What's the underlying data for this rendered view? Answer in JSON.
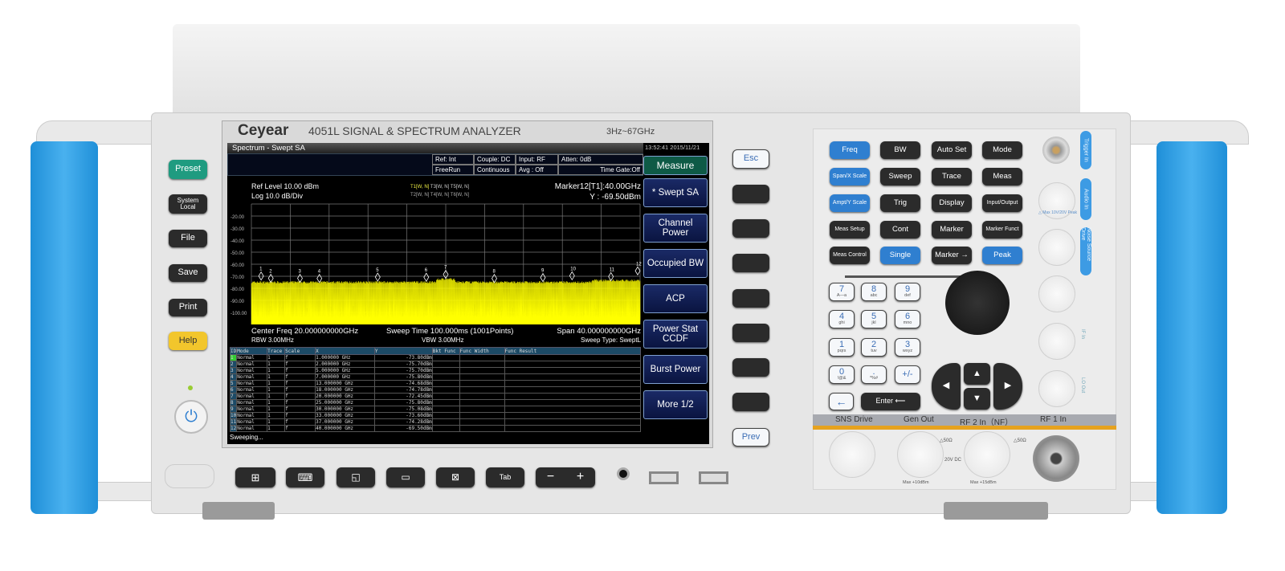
{
  "header": {
    "brand": "Ceyear",
    "model": "4051L  SIGNAL & SPECTRUM ANALYZER",
    "range": "3Hz~67GHz"
  },
  "screen": {
    "title": "Spectrum - Swept SA",
    "datetime": "13:52:41  2015/11/21",
    "status": {
      "ref": "Ref: Int",
      "couple": "Couple: DC",
      "input": "Input: RF",
      "atten": "Atten: 0dB",
      "trigger": "FreeRun",
      "sweep": "Continuous",
      "avg": "Avg : Off",
      "timegate": "Time Gate:Off"
    },
    "ref_level": "Ref Level  10.00 dBm",
    "scale": "Log 10.0 dB/Div",
    "traces_row1": [
      "T1[W, N]",
      "T3[W, N]",
      "T5[W, N]"
    ],
    "traces_row2": [
      "T2[W, N]",
      "T4[W, N]",
      "T6[W, N]"
    ],
    "marker_readout": "Marker12[T1]:40.00GHz",
    "marker_y": "Y : -69.50dBm",
    "center": "Center Freq 20.000000000GHz",
    "sweep_time": "Sweep Time 100.000ms (1001Points)",
    "span": "Span 40.000000000GHz",
    "rbw": "RBW 3.00MHz",
    "vbw": "VBW 3.00MHz",
    "sweep_type": "Sweep Type: SweptL",
    "status_line": "Sweeping...",
    "table_headers": [
      "ID",
      "Mode",
      "Trace",
      "Scale",
      "X",
      "Y",
      "Bkt Func",
      "Func Width",
      "Func Result"
    ],
    "table_rows": [
      [
        "1",
        "Normal",
        "1",
        "f",
        "1.000000 GHz",
        "-73.80dBm"
      ],
      [
        "2",
        "Normal",
        "1",
        "f",
        "2.000000 GHz",
        "-75.70dBm"
      ],
      [
        "3",
        "Normal",
        "1",
        "f",
        "5.000000 GHz",
        "-75.70dBm"
      ],
      [
        "4",
        "Normal",
        "1",
        "f",
        "7.000000 GHz",
        "-75.80dBm"
      ],
      [
        "5",
        "Normal",
        "1",
        "f",
        "13.000000 GHz",
        "-74.68dBm"
      ],
      [
        "6",
        "Normal",
        "1",
        "f",
        "18.000000 GHz",
        "-74.78dBm"
      ],
      [
        "7",
        "Normal",
        "1",
        "f",
        "20.000000 GHz",
        "-72.45dBm"
      ],
      [
        "8",
        "Normal",
        "1",
        "f",
        "25.000000 GHz",
        "-75.80dBm"
      ],
      [
        "9",
        "Normal",
        "1",
        "f",
        "30.000000 GHz",
        "-75.08dBm"
      ],
      [
        "10",
        "Normal",
        "1",
        "f",
        "33.000000 GHz",
        "-73.60dBm"
      ],
      [
        "11",
        "Normal",
        "1",
        "f",
        "37.000000 GHz",
        "-74.28dBm"
      ],
      [
        "12",
        "Normal",
        "1",
        "f",
        "40.000000 GHz",
        "-69.50dBm"
      ]
    ]
  },
  "chart_data": {
    "type": "line",
    "title": "",
    "xlabel": "",
    "ylabel": "",
    "x_range_ghz": [
      0,
      40
    ],
    "ylim": [
      -110,
      -10
    ],
    "grid": true,
    "y_ticks": [
      "-20.00",
      "-30.00",
      "-40.00",
      "-50.00",
      "-60.00",
      "-70.00",
      "-80.00",
      "-90.00",
      "-100.00"
    ],
    "trace_color": "#ffff00",
    "noise_floor_dbm": -76,
    "markers": [
      {
        "label": "1",
        "x": 1,
        "y": -73.8
      },
      {
        "label": "2",
        "x": 2,
        "y": -75.7
      },
      {
        "label": "3",
        "x": 5,
        "y": -75.7
      },
      {
        "label": "4",
        "x": 7,
        "y": -75.8
      },
      {
        "label": "5",
        "x": 13,
        "y": -74.68
      },
      {
        "label": "6",
        "x": 18,
        "y": -74.78
      },
      {
        "label": "7",
        "x": 20,
        "y": -72.45
      },
      {
        "label": "8",
        "x": 25,
        "y": -75.8
      },
      {
        "label": "9",
        "x": 30,
        "y": -75.08
      },
      {
        "label": "10",
        "x": 33,
        "y": -73.6
      },
      {
        "label": "11",
        "x": 37,
        "y": -74.28
      },
      {
        "label": "12",
        "x": 40,
        "y": -69.5
      }
    ]
  },
  "softkeys": [
    "Measure",
    "* Swept SA",
    "Channel Power",
    "Occupied BW",
    "ACP",
    "Power Stat CCDF",
    "Burst Power",
    "More 1/2"
  ],
  "side_keys": {
    "esc": "Esc",
    "prev": "Prev"
  },
  "left_keys": {
    "preset": "Preset",
    "system": "System Local",
    "file": "File",
    "save": "Save",
    "print": "Print",
    "help": "Help"
  },
  "bottom_keys": {
    "tab": "Tab",
    "minus": "−",
    "plus": "+"
  },
  "function_keys": [
    [
      "Freq",
      "BW",
      "Auto Set",
      "Mode"
    ],
    [
      "Span/X Scale",
      "Sweep",
      "Trace",
      "Meas"
    ],
    [
      "Ampt/Y Scale",
      "Trig",
      "Display",
      "Input/Output"
    ],
    [
      "Meas Setup",
      "Cont",
      "Marker",
      "Marker Funct"
    ],
    [
      "Meas Control",
      "Single",
      "Marker →",
      "Peak"
    ]
  ],
  "numpad": [
    [
      "7",
      "A—a"
    ],
    [
      "8",
      "abc"
    ],
    [
      "9",
      "def"
    ],
    [
      "4",
      "ghi"
    ],
    [
      "5",
      "jkl"
    ],
    [
      "6",
      "mno"
    ],
    [
      "1",
      "pqrs"
    ],
    [
      "2",
      "tuv"
    ],
    [
      "3",
      "wxyz"
    ],
    [
      "0",
      "!@&"
    ],
    [
      ".",
      "*%#"
    ],
    [
      "+/-",
      ""
    ]
  ],
  "enter": "Enter ⟵",
  "ports": {
    "sns": "SNS Drive",
    "gen": "Gen Out",
    "rf2": "RF 2 In（NF）",
    "rf1": "RF 1 In",
    "gen_max": "Max +10dBm",
    "rf2_max": "Max +15dBm",
    "ohm1": "△50Ω",
    "ohm2": "△50Ω",
    "dc": "20V DC"
  },
  "side_ports": [
    "Trigger In",
    "Audio In",
    "Noise Source Drive",
    "IF In",
    "LO Out"
  ],
  "side_warn": "△ Max 10V/20V Peak",
  "colors": {
    "accent_blue": "#2f7fd0",
    "handle": "#2a9be6",
    "trace": "#ffff00",
    "softkey": "#0e1a55",
    "measure": "#0e5a46"
  }
}
